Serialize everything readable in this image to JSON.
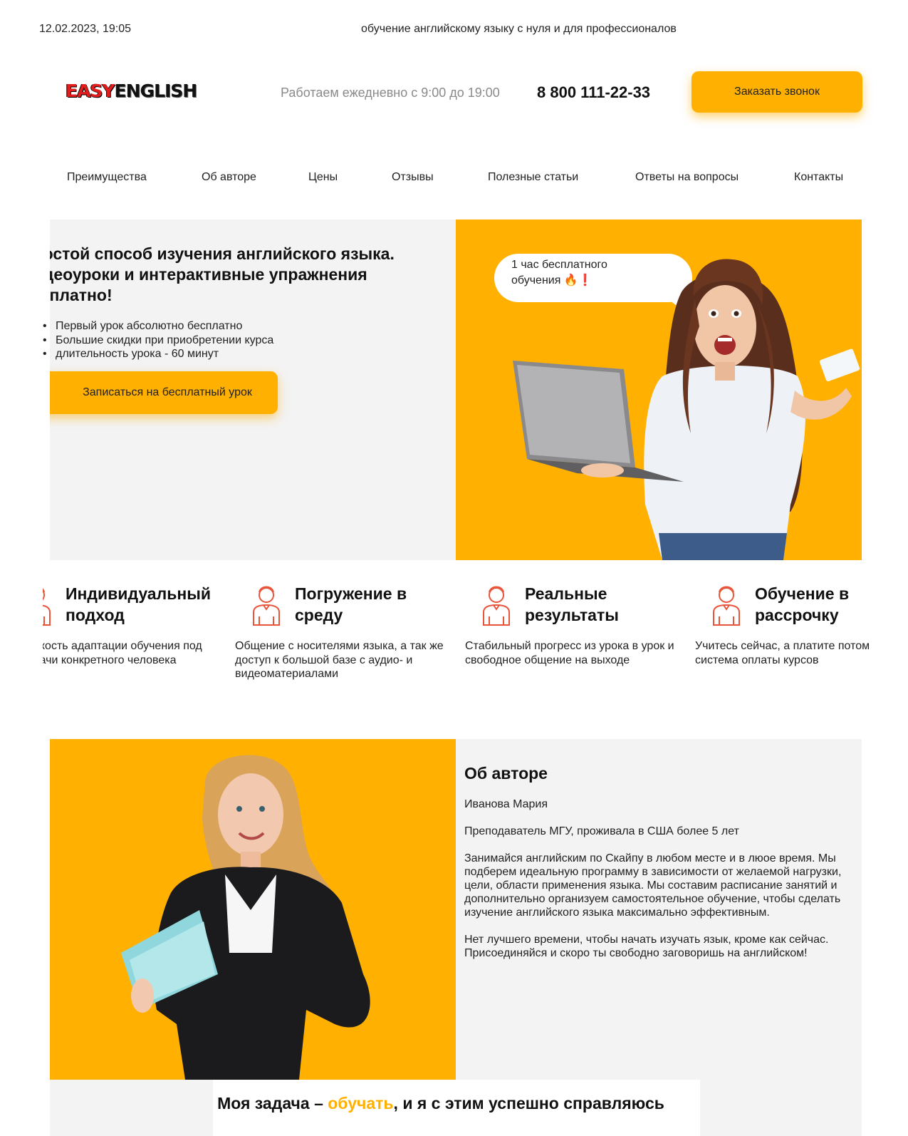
{
  "print_header": {
    "datetime": "12.02.2023, 19:05",
    "page_title": "обучение английскому языку с нуля и для профессионалов"
  },
  "header": {
    "logo": {
      "part1": "EASY",
      "part2": "ENGLISH"
    },
    "work_hours": "Работаем ежедневно с 9:00 до 19:00",
    "phone": "8 800 111-22-33",
    "call_button": "Заказать звонок"
  },
  "nav": {
    "items": [
      {
        "label": "Преимущества"
      },
      {
        "label": "Об авторе"
      },
      {
        "label": "Цены"
      },
      {
        "label": "Отзывы"
      },
      {
        "label": "Полезные статьи"
      },
      {
        "label": "Ответы на вопросы"
      },
      {
        "label": "Контакты"
      }
    ]
  },
  "hero": {
    "heading_lines": [
      "Простой способ изучения английского языка.",
      "Видеоуроки и интерактивные упражнения",
      "бесплатно!"
    ],
    "bullets": [
      "Первый урок абсолютно бесплатно",
      "Большие скидки при приобретении курса",
      "длительность урока - 60 минут"
    ],
    "cta_button": "Записаться на бесплатный урок",
    "bubble_line1": "1 час бесплатного",
    "bubble_line2": "обучения 🔥❗"
  },
  "features": [
    {
      "title_line1": "Индивидуальный",
      "title_line2": "подход",
      "text": "Гибкость адаптации обучения под задачи конкретного человека",
      "icon": "teacher-icon"
    },
    {
      "title_line1": "Погружение в",
      "title_line2": "среду",
      "text": "Общение с носителями языка, а так же доступ к большой базе с аудио- и видеоматериалами",
      "icon": "teacher-icon"
    },
    {
      "title_line1": "Реальные",
      "title_line2": "результаты",
      "text": "Стабильный прогресс из урока в урок и свободное общение на выходе",
      "icon": "teacher-icon"
    },
    {
      "title_line1": "Обучение в",
      "title_line2": "рассрочку",
      "text": "Учитесь сейчас, а платите потом гибкая система оплаты курсов",
      "icon": "teacher-icon"
    }
  ],
  "author": {
    "heading": "Об авторе",
    "name": "Иванова Мария",
    "position": "Преподаватель МГУ, проживала в США более 5 лет",
    "paragraph1": "Занимайся английским по Скайпу в любом месте и в люое время. Мы подберем идеальную программу в зависимости от желаемой нагрузки, цели, области применения языка. Мы составим расписание занятий и дополнительно организуем самостоятельное обучение, чтобы сделать изучение английского языка максимально эффективным.",
    "paragraph2": "Нет лучшего времени, чтобы начать изучать язык, кроме как сейчас. Присоединяйся и скоро ты свободно заговоришь на английском!"
  },
  "mission": {
    "prefix": "Моя задача – ",
    "accent": "обучать",
    "suffix": ", и я с этим успешно справляюсь"
  },
  "colors": {
    "accent": "#ffb000",
    "panel": "#f3f3f3",
    "icon": "#e8553a"
  }
}
